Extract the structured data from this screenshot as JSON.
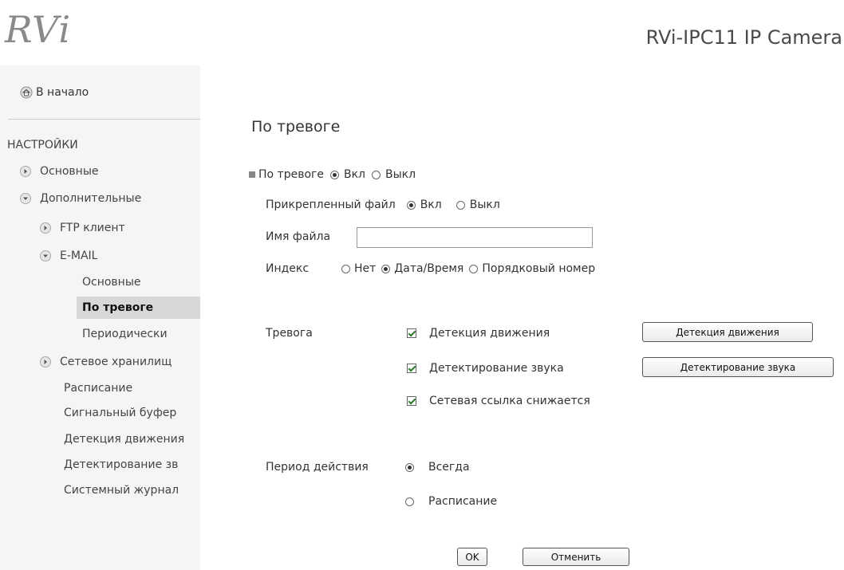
{
  "header": {
    "logo_text": "RVi",
    "title": "RVi-IPC11 IP Camera"
  },
  "sidebar": {
    "home_label": "В начало",
    "section_title": "НАСТРОЙКИ",
    "items": {
      "basic": "Основные",
      "advanced": "Дополнительные",
      "ftp": "FTP клиент",
      "email": "E-MAIL",
      "email_basic": "Основные",
      "email_alarm": "По тревоге",
      "email_periodic": "Периодически",
      "network_storage": "Сетевое хранилищ",
      "schedule": "Расписание",
      "signal_buffer": "Сигнальный буфер",
      "motion_detection": "Детекция движения",
      "audio_detection": "Детектирование зв",
      "system_log": "Системный журнал"
    }
  },
  "main": {
    "title": "По тревоге",
    "alarm": {
      "label": "По тревоге",
      "on_label": "Вкл",
      "off_label": "Выкл",
      "value": "on"
    },
    "attached_file": {
      "label": "Прикрепленный файл",
      "on_label": "Вкл",
      "off_label": "Выкл",
      "value": "on"
    },
    "filename": {
      "label": "Имя файла",
      "value": ""
    },
    "index": {
      "label": "Индекс",
      "options": [
        "Нет",
        "Дата/Время",
        "Порядковый номер"
      ],
      "selected": "Дата/Время"
    },
    "trigger": {
      "label": "Тревога",
      "motion_label": "Детекция движения",
      "motion_checked": true,
      "motion_button": "Детекция движения",
      "audio_label": "Детектирование звука",
      "audio_checked": true,
      "audio_button": "Детектирование звука",
      "network_label": "Сетевая ссылка снижается",
      "network_checked": true
    },
    "period": {
      "label": "Период действия",
      "always_label": "Всегда",
      "schedule_label": "Расписание",
      "selected": "always"
    },
    "buttons": {
      "ok": "OK",
      "cancel": "Отменить"
    }
  },
  "colors": {
    "sidebar_bg": "#f5f5f5",
    "active_item_bg": "#d8d8d8",
    "logo": "#8a8a8a"
  }
}
